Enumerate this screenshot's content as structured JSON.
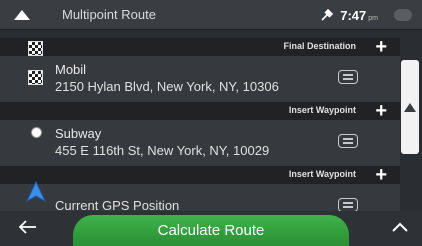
{
  "header": {
    "title": "Multipoint Route",
    "time": "7:47",
    "ampm": "pm"
  },
  "route": {
    "final_destination_label": "Final Destination",
    "insert_waypoint_label": "Insert Waypoint",
    "stops": [
      {
        "name": "Mobil",
        "address": "2150 Hylan Blvd, New York, NY, 10306"
      },
      {
        "name": "Subway",
        "address": "455 E 116th St, New York, NY, 10029"
      },
      {
        "name": "Current GPS Position"
      }
    ]
  },
  "footer": {
    "calculate_label": "Calculate Route"
  },
  "colors": {
    "route_line": "#f08a1a",
    "calculate_button": "#3fb24a"
  }
}
